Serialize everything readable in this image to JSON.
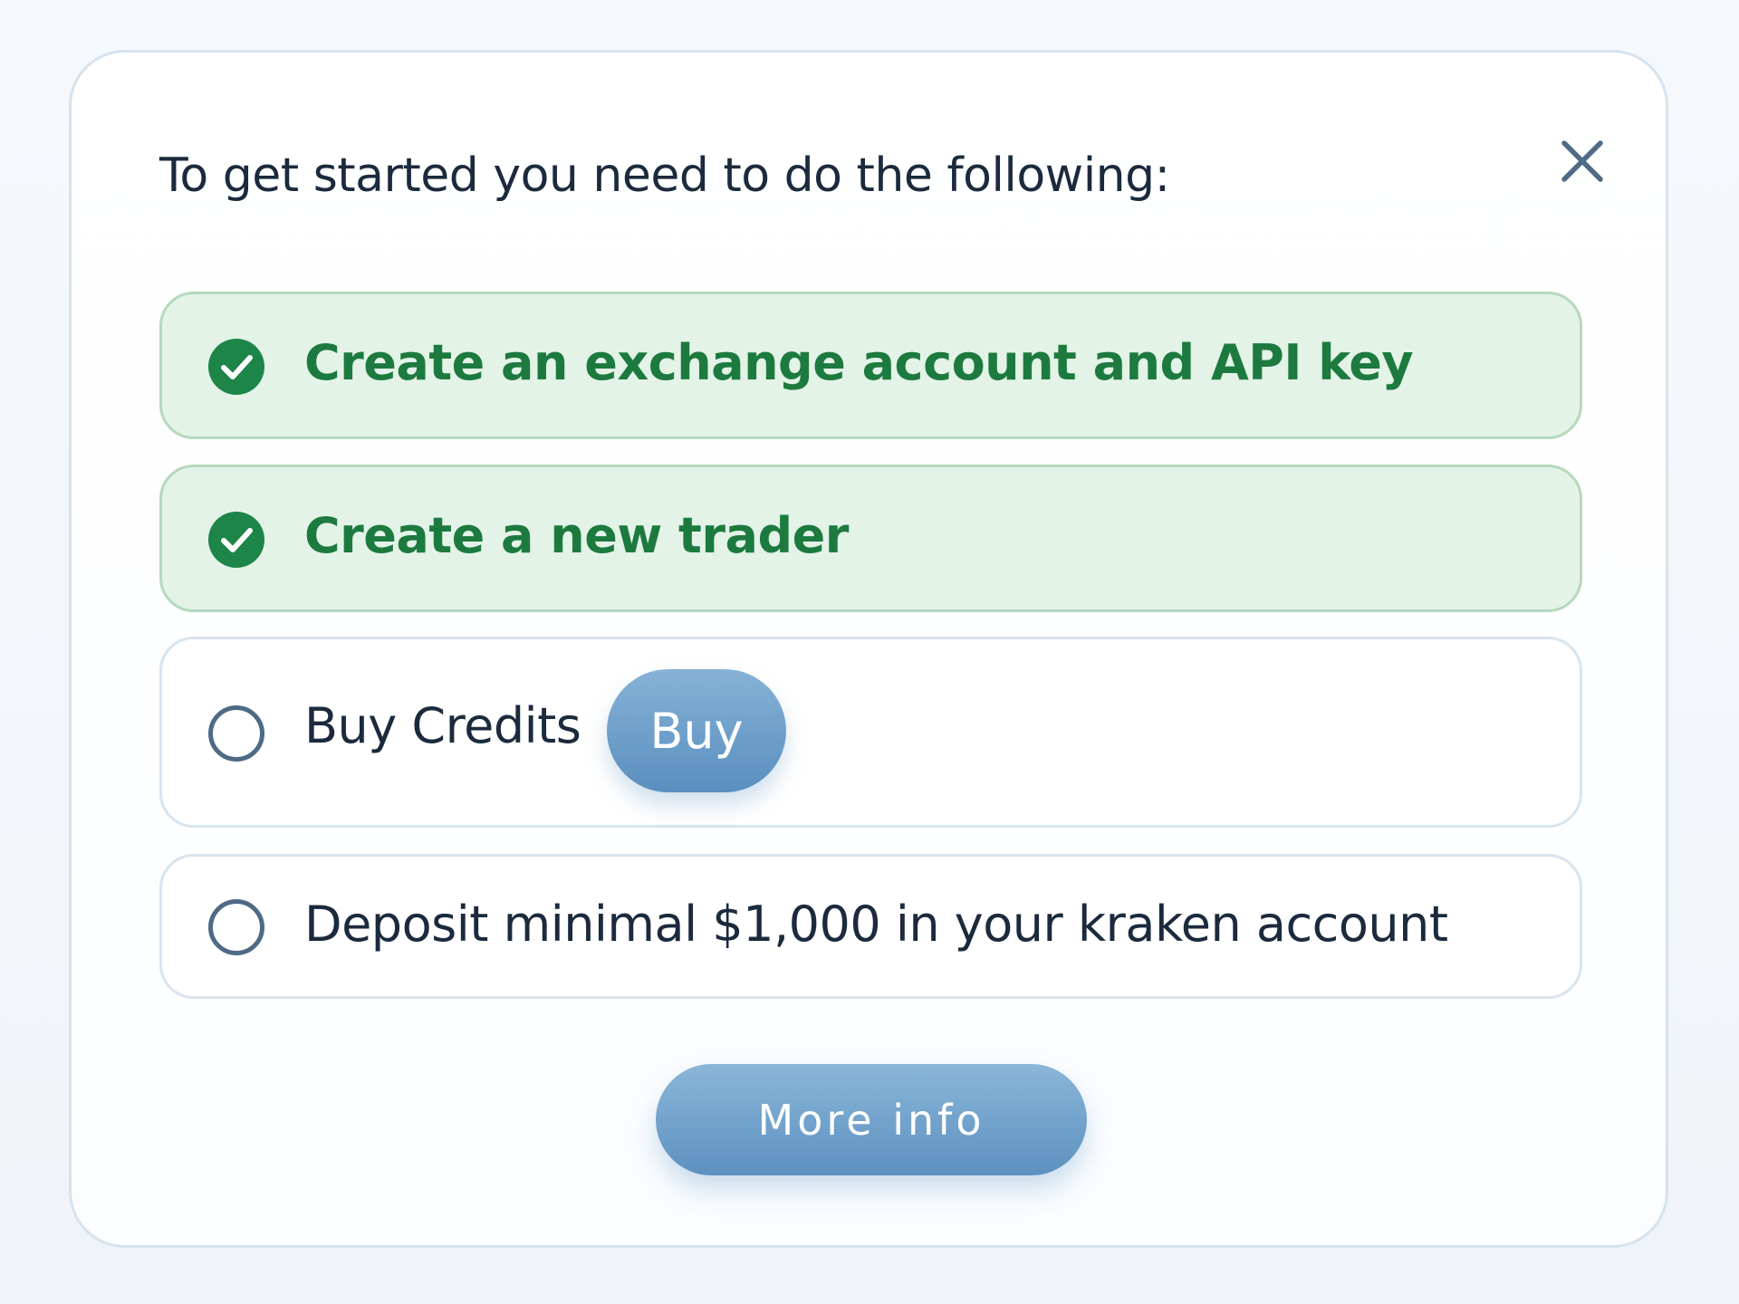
{
  "dialog": {
    "heading": "To get started you need to do the following:",
    "close_icon": "close-icon",
    "tasks": [
      {
        "label": "Create an exchange account and API key",
        "completed": true,
        "icon": "check-circle-icon"
      },
      {
        "label": "Create a new trader",
        "completed": true,
        "icon": "check-circle-icon"
      },
      {
        "label": "Buy Credits",
        "completed": false,
        "icon": "empty-circle-icon",
        "action_label": "Buy"
      },
      {
        "label": "Deposit minimal $1,000 in your kraken account",
        "completed": false,
        "icon": "empty-circle-icon"
      }
    ],
    "more_info_label": "More info"
  },
  "colors": {
    "done_text": "#1d7a3f",
    "done_background": "#e3f3e7",
    "done_border": "#b5d9be",
    "pending_icon": "#4e6a84",
    "button_blue": "#6f9fca",
    "text_dark": "#1b2a3c"
  }
}
